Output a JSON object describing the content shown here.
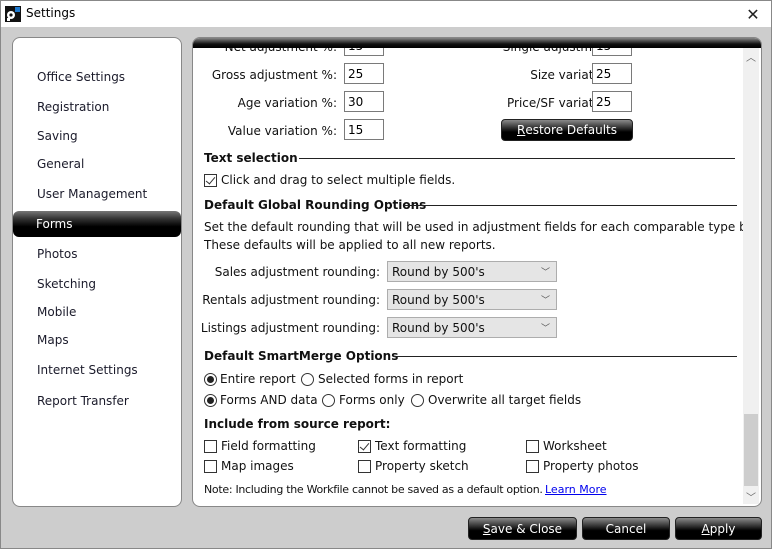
{
  "window": {
    "title": "Settings",
    "close_icon": "close-icon",
    "app_icon": "app-logo-icon"
  },
  "sidebar": {
    "items": [
      {
        "label": "Office Settings",
        "active": false
      },
      {
        "label": "Registration",
        "active": false
      },
      {
        "label": "Saving",
        "active": false
      },
      {
        "label": "General",
        "active": false
      },
      {
        "label": "User Management",
        "active": false
      },
      {
        "label": "Forms",
        "active": true
      },
      {
        "label": "Photos",
        "active": false
      },
      {
        "label": "Sketching",
        "active": false
      },
      {
        "label": "Mobile",
        "active": false
      },
      {
        "label": "Maps",
        "active": false
      },
      {
        "label": "Internet Settings",
        "active": false
      },
      {
        "label": "Report Transfer",
        "active": false
      }
    ]
  },
  "adjustments": {
    "left": [
      {
        "label": "Net adjustment %:",
        "value": "15"
      },
      {
        "label": "Gross adjustment %:",
        "value": "25"
      },
      {
        "label": "Age variation %:",
        "value": "30"
      },
      {
        "label": "Value variation %:",
        "value": "15"
      }
    ],
    "right": [
      {
        "label": "Single adjustment %:",
        "value": "15"
      },
      {
        "label": "Size variation %:",
        "value": "25"
      },
      {
        "label": "Price/SF variation %:",
        "value": "25"
      }
    ],
    "restore_button": {
      "mnemonic": "R",
      "rest": "estore Defaults"
    }
  },
  "text_selection": {
    "heading": "Text selection",
    "checkbox_label": "Click and drag to select multiple fields.",
    "checked": true
  },
  "rounding": {
    "heading": "Default Global Rounding Options",
    "description_line1": "Set the default rounding that will be used in adjustment fields for each comparable type below.",
    "description_line2": "These defaults will be applied to all new reports.",
    "rows": [
      {
        "label": "Sales adjustment rounding:",
        "value": "Round by 500's"
      },
      {
        "label": "Rentals adjustment rounding:",
        "value": "Round by 500's"
      },
      {
        "label": "Listings adjustment rounding:",
        "value": "Round by 500's"
      }
    ]
  },
  "smartmerge": {
    "heading": "Default SmartMerge Options",
    "scope": [
      {
        "label": "Entire report",
        "selected": true
      },
      {
        "label": "Selected forms in report",
        "selected": false
      }
    ],
    "mode": [
      {
        "label": "Forms AND data",
        "selected": true
      },
      {
        "label": "Forms only",
        "selected": false
      },
      {
        "label": "Overwrite all target fields",
        "selected": false
      }
    ],
    "include_heading": "Include from source report:",
    "include": [
      {
        "label": "Field formatting",
        "checked": false
      },
      {
        "label": "Text formatting",
        "checked": true
      },
      {
        "label": "Worksheet",
        "checked": false
      },
      {
        "label": "Map images",
        "checked": false
      },
      {
        "label": "Property sketch",
        "checked": false
      },
      {
        "label": "Property photos",
        "checked": false
      }
    ],
    "note": "Note: Including the Workfile cannot be saved as a default option.",
    "learn_more": "Learn More"
  },
  "footer": {
    "save_close": {
      "mnemonic": "S",
      "rest": "ave & Close"
    },
    "cancel": "Cancel",
    "apply": {
      "mnemonic": "A",
      "rest": "pply"
    }
  }
}
